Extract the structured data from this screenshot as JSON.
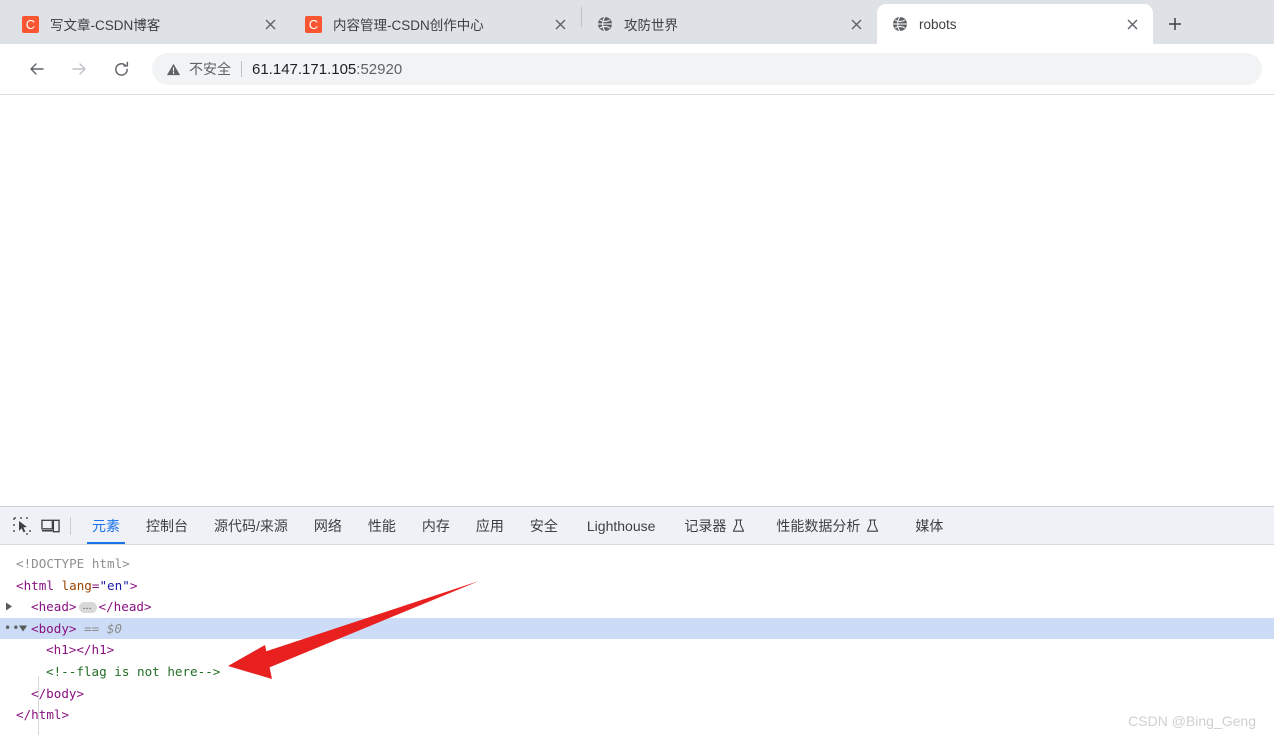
{
  "browser": {
    "tabs": [
      {
        "title": "写文章-CSDN博客",
        "favicon": "csdn-logo-icon",
        "active": false,
        "close_label": "×"
      },
      {
        "title": "内容管理-CSDN创作中心",
        "favicon": "csdn-logo-icon",
        "active": false,
        "close_label": "×"
      },
      {
        "title": "攻防世界",
        "favicon": "globe-icon",
        "active": false,
        "close_label": "×"
      },
      {
        "title": "robots",
        "favicon": "globe-icon",
        "active": true,
        "close_label": "×"
      }
    ],
    "new_tab_label": "+",
    "toolbar": {
      "back_label": "←",
      "forward_label": "→",
      "reload_label": "⟳",
      "security_text": "不安全",
      "url_host": "61.147.171.105",
      "url_port": ":52920"
    }
  },
  "devtools": {
    "left_icons": [
      {
        "name": "inspect-element-icon"
      },
      {
        "name": "device-toolbar-icon"
      }
    ],
    "tabs": [
      {
        "label": "元素",
        "active": true,
        "experimental": false
      },
      {
        "label": "控制台",
        "active": false,
        "experimental": false
      },
      {
        "label": "源代码/来源",
        "active": false,
        "experimental": false
      },
      {
        "label": "网络",
        "active": false,
        "experimental": false
      },
      {
        "label": "性能",
        "active": false,
        "experimental": false
      },
      {
        "label": "内存",
        "active": false,
        "experimental": false
      },
      {
        "label": "应用",
        "active": false,
        "experimental": false
      },
      {
        "label": "安全",
        "active": false,
        "experimental": false
      },
      {
        "label": "Lighthouse",
        "active": false,
        "experimental": false
      },
      {
        "label": "记录器",
        "active": false,
        "experimental": true
      },
      {
        "label": "性能数据分析",
        "active": false,
        "experimental": true
      },
      {
        "label": "媒体",
        "active": false,
        "experimental": false
      }
    ],
    "dom": {
      "doctype": "<!DOCTYPE html>",
      "html_open_lt": "<",
      "html_tag": "html",
      "html_attr_name": "lang",
      "html_attr_eq": "=",
      "html_attr_val": "\"en\"",
      "html_open_gt": ">",
      "head_open": "<head>",
      "head_ellipsis": "…",
      "head_close": "</head>",
      "body_open": "<body>",
      "body_selected_marker": "== $0",
      "h1_line": "<h1></h1>",
      "comment_line": "<!--flag is not here-->",
      "body_close": "</body>",
      "html_close": "</html>"
    }
  },
  "annotation": {
    "arrow": "red-arrow-pointing-to-comment",
    "arrow_color": "#e8201f"
  },
  "watermark": "CSDN @Bing_Geng"
}
